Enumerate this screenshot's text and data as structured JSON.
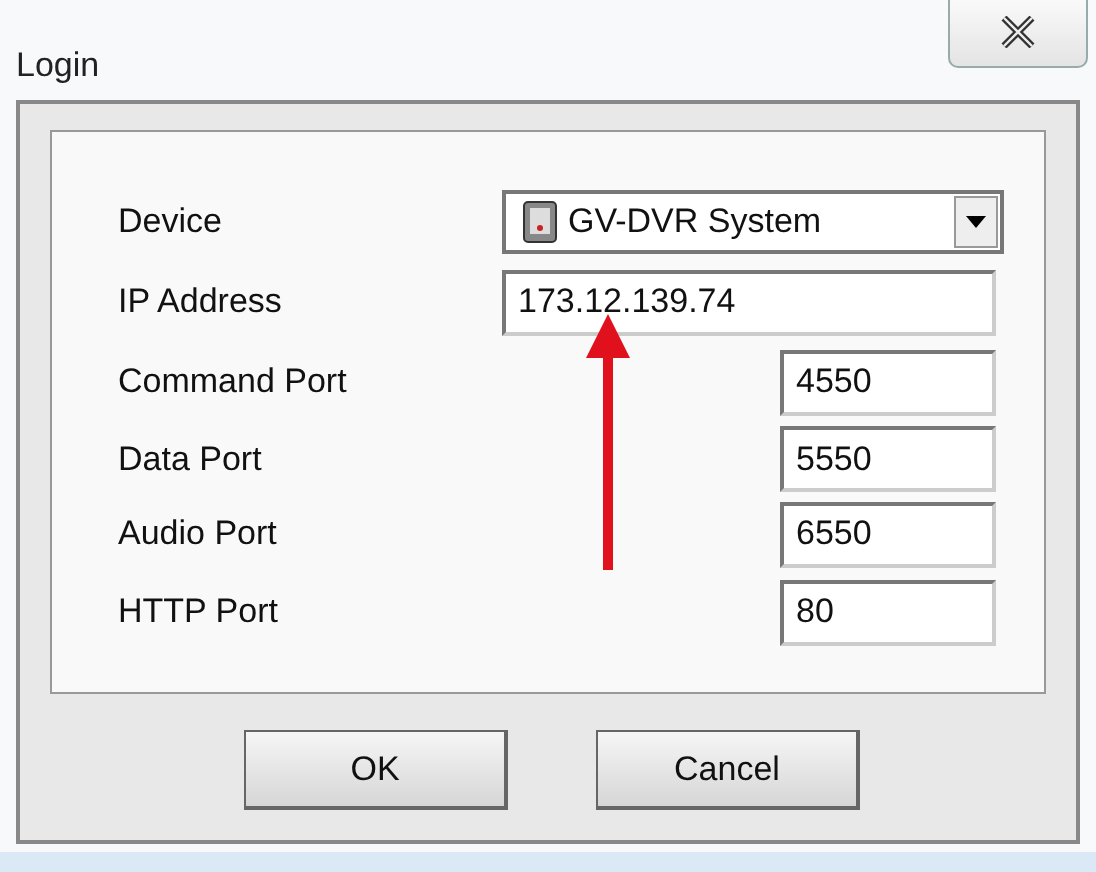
{
  "window": {
    "title": "Login"
  },
  "fields": [
    {
      "label": "Device",
      "kind": "dropdown",
      "value": "GV-DVR System"
    },
    {
      "label": "IP Address",
      "kind": "wide",
      "value": "173.12.139.74"
    },
    {
      "label": "Command Port",
      "kind": "short",
      "value": "4550"
    },
    {
      "label": "Data Port",
      "kind": "short",
      "value": "5550"
    },
    {
      "label": "Audio Port",
      "kind": "short",
      "value": "6550"
    },
    {
      "label": "HTTP Port",
      "kind": "short",
      "value": "80"
    }
  ],
  "buttons": [
    "OK",
    "Cancel"
  ]
}
